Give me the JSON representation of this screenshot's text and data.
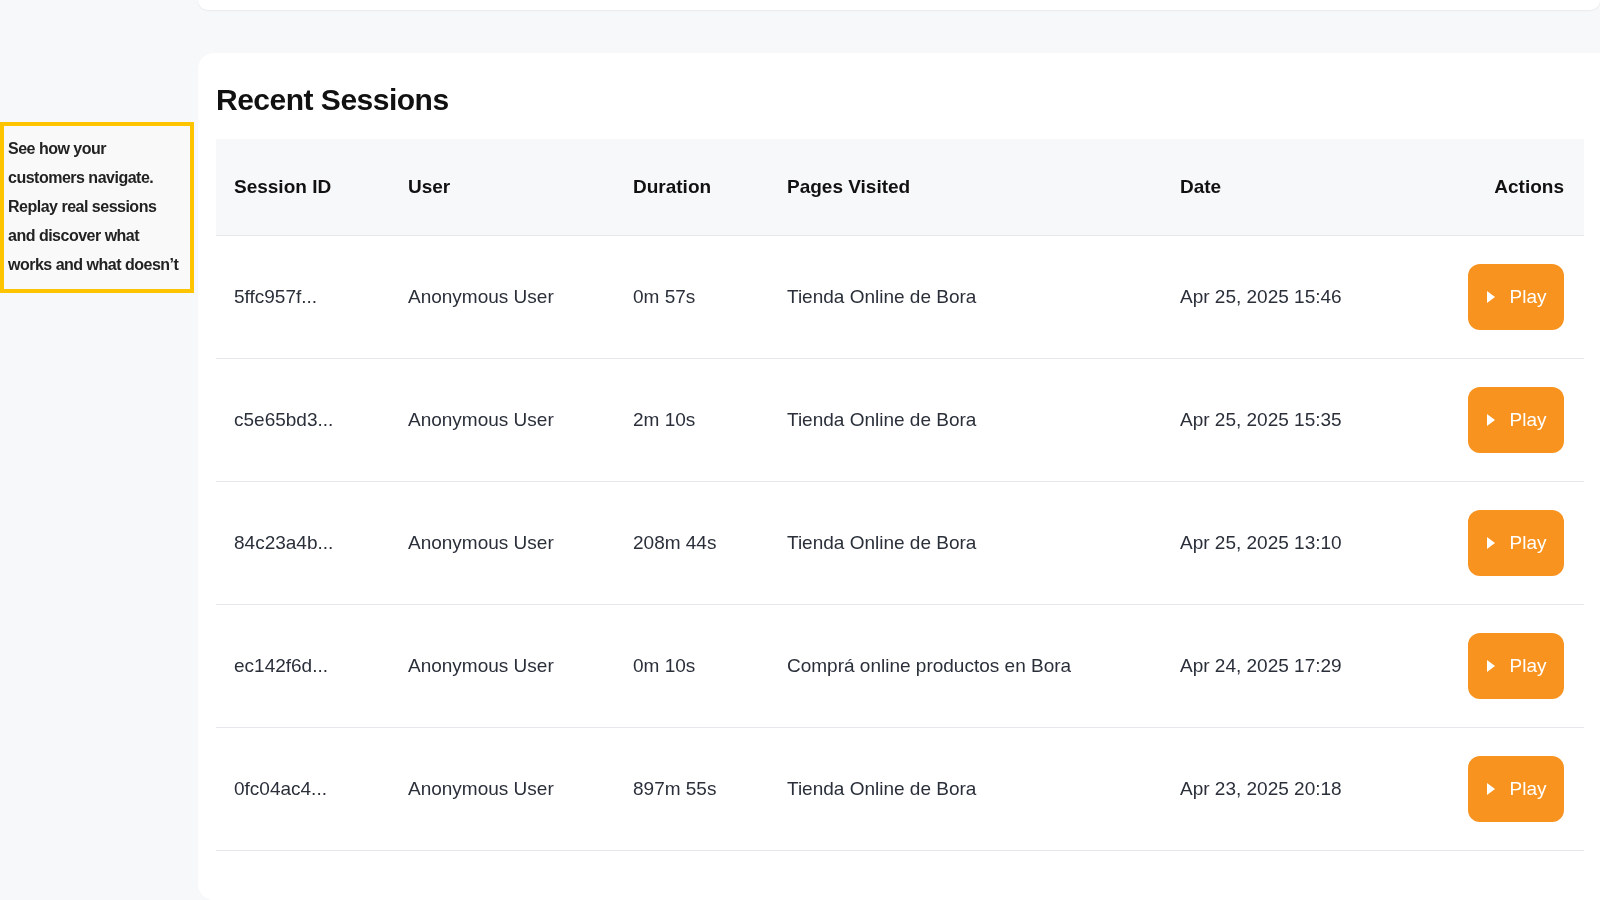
{
  "callout": {
    "text": "See how your customers navigate. Replay real sessions and discover what works and what doesn’t"
  },
  "sessions_card": {
    "title": "Recent Sessions",
    "table": {
      "columns": [
        "Session ID",
        "User",
        "Duration",
        "Pages Visited",
        "Date",
        "Actions"
      ],
      "rows": [
        {
          "session_id": "5ffc957f...",
          "user": "Anonymous User",
          "duration": "0m 57s",
          "pages_visited": "Tienda Online de Bora",
          "date": "Apr 25, 2025 15:46",
          "action": "Play"
        },
        {
          "session_id": "c5e65bd3...",
          "user": "Anonymous User",
          "duration": "2m 10s",
          "pages_visited": "Tienda Online de Bora",
          "date": "Apr 25, 2025 15:35",
          "action": "Play"
        },
        {
          "session_id": "84c23a4b...",
          "user": "Anonymous User",
          "duration": "208m 44s",
          "pages_visited": "Tienda Online de Bora",
          "date": "Apr 25, 2025 13:10",
          "action": "Play"
        },
        {
          "session_id": "ec142f6d...",
          "user": "Anonymous User",
          "duration": "0m 10s",
          "pages_visited": "Comprá online productos en Bora",
          "date": "Apr 24, 2025 17:29",
          "action": "Play"
        },
        {
          "session_id": "0fc04ac4...",
          "user": "Anonymous User",
          "duration": "897m 55s",
          "pages_visited": "Tienda Online de Bora",
          "date": "Apr 23, 2025 20:18",
          "action": "Play"
        }
      ]
    }
  }
}
